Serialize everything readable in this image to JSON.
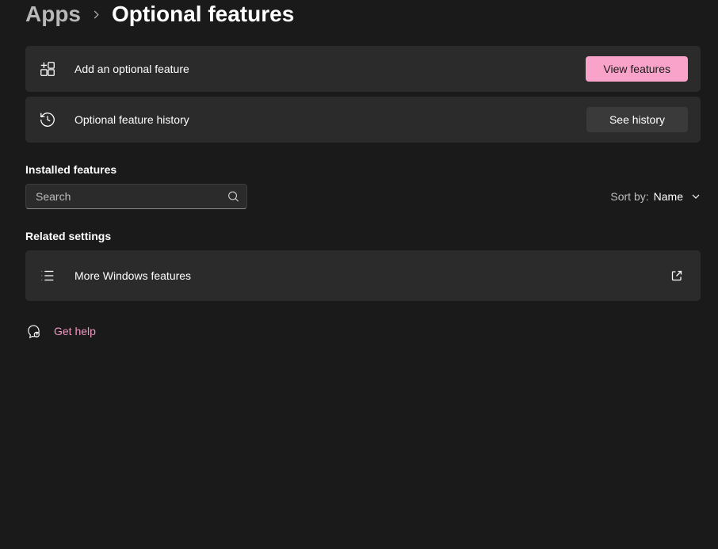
{
  "breadcrumb": {
    "previous": "Apps",
    "current": "Optional features"
  },
  "cards": {
    "add": {
      "label": "Add an optional feature",
      "button": "View features"
    },
    "history": {
      "label": "Optional feature history",
      "button": "See history"
    }
  },
  "installed": {
    "header": "Installed features",
    "search_placeholder": "Search",
    "sort_label": "Sort by:",
    "sort_value": "Name"
  },
  "related": {
    "header": "Related settings",
    "more_features": "More Windows features"
  },
  "help": {
    "label": "Get help"
  }
}
